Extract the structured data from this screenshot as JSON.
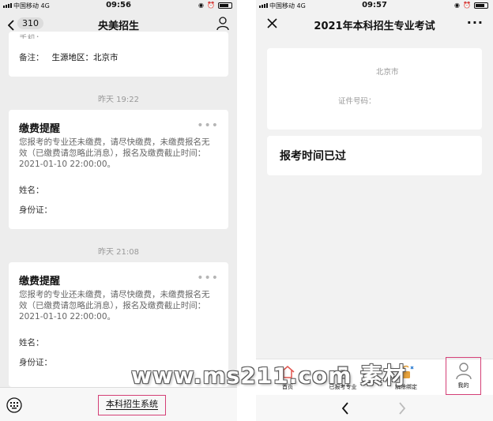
{
  "left": {
    "status": {
      "carrier": "中国移动",
      "network": "4G",
      "time": "09:56"
    },
    "nav": {
      "badge": "310",
      "title": "央美招生"
    },
    "top_card": {
      "partial_label": "手机：",
      "remark_label": "备注：",
      "remark_value": "生源地区：北京市"
    },
    "messages": [
      {
        "timestamp": "昨天 19:22",
        "title": "缴费提醒",
        "body": "您报考的专业还未缴费，请尽快缴费，未缴费报名无效（已缴费请忽略此消息），报名及缴费截止时间：2021-01-10 22:00:00。",
        "name_label": "姓名：",
        "id_label": "身份证："
      },
      {
        "timestamp": "昨天 21:08",
        "title": "缴费提醒",
        "body": "您报考的专业还未缴费，请尽快缴费，未缴费报名无效（已缴费请忽略此消息），报名及缴费截止时间：2021-01-10 22:00:00。",
        "name_label": "姓名：",
        "id_label": "身份证："
      }
    ],
    "bottom": {
      "menu_label": "本科招生系统"
    }
  },
  "right": {
    "status": {
      "carrier": "中国移动",
      "network": "4G",
      "time": "09:57"
    },
    "nav": {
      "title": "2021年本科招生专业考试"
    },
    "info_card": {
      "region": "北京市",
      "id_label": "证件号码："
    },
    "notice": "报考时间已过",
    "tabs": [
      {
        "label": "首页",
        "icon": "home-icon"
      },
      {
        "label": "已报考专业",
        "icon": "list-icon"
      },
      {
        "label": "解除绑定",
        "icon": "unlock-icon"
      },
      {
        "label": "我的",
        "icon": "person-icon",
        "highlighted": true
      }
    ]
  },
  "watermark": "www.ms211.com 素材",
  "colors": {
    "highlight": "#d43f76",
    "panel_bg": "#ededed",
    "card_bg": "#ffffff"
  }
}
